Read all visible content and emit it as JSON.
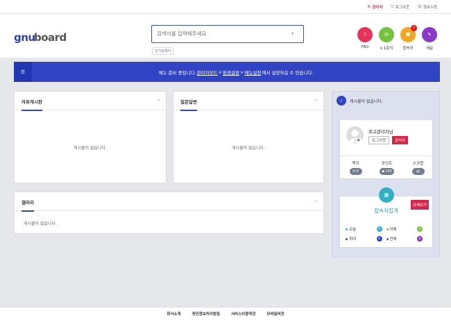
{
  "topbar": {
    "admin": "관리자",
    "logout": "로그아웃",
    "profile_edit": "정보수정"
  },
  "header": {
    "logo_text": "gnuboard",
    "search_placeholder": "검색어를 입력해주세요",
    "popular_label": "인기검색어",
    "quick": [
      {
        "label": "FAQ",
        "icon": "faq-icon",
        "color": "#e8335a"
      },
      {
        "label": "1:1문의",
        "icon": "question-icon",
        "color": "#73c23d"
      },
      {
        "label": "접속자",
        "icon": "users-icon",
        "color": "#f3a61f",
        "badge": "0"
      },
      {
        "label": "새글",
        "icon": "new-post-icon",
        "color": "#8a38c7"
      }
    ]
  },
  "notice": {
    "prefix": "메뉴 준비 중입니다. ",
    "link1": "관리자모드",
    "sep1": " > ",
    "link2": "환경설정",
    "sep2": " > ",
    "link3": "메뉴설정",
    "suffix": "에서 설정하실 수 있습니다."
  },
  "panels": {
    "free": {
      "title": "자유게시판",
      "empty": "게시물이 없습니다."
    },
    "qa": {
      "title": "질문답변",
      "empty": "게시물이 없습니다."
    },
    "gallery": {
      "title": "갤러리",
      "empty": "게시물이 없습니다."
    }
  },
  "sidebar": {
    "notice_text": "게시물이 없습니다.",
    "profile": {
      "name": "최고관리자님",
      "logout": "로그아웃",
      "admin": "관리자",
      "stats": [
        {
          "label": "쪽지",
          "value": "0"
        },
        {
          "label": "포인트",
          "value": "100"
        },
        {
          "label": "스크랩",
          "value": ""
        }
      ]
    },
    "visitors": {
      "title": "접속자집계",
      "detail": "상세보기",
      "today_label": "오늘",
      "today": "0",
      "yesterday_label": "어제",
      "yesterday": "0",
      "max_label": "최대",
      "max": "0",
      "total_label": "전체",
      "total": "0"
    }
  },
  "footer": {
    "items": [
      "회사소개",
      "개인정보처리방침",
      "서비스이용약관",
      "모바일버전"
    ]
  },
  "colors": {
    "brand": "#3144c4",
    "accent_red": "#d6264b",
    "visit_teal": "#2fb0c6"
  }
}
